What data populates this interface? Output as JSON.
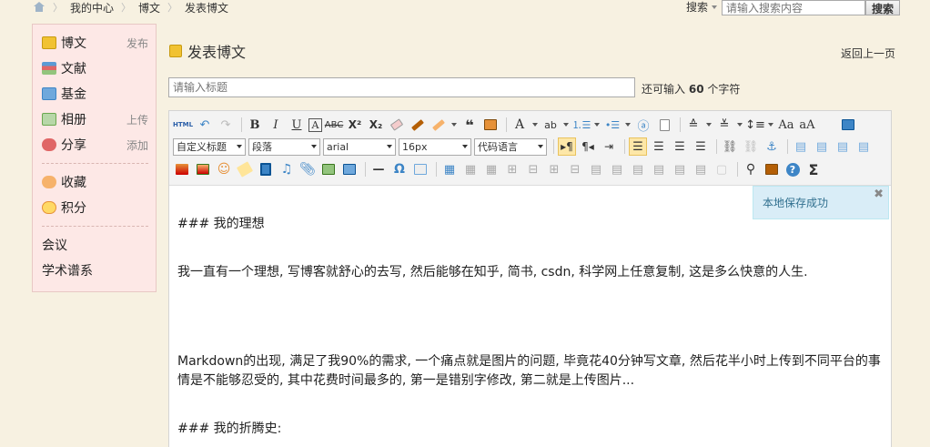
{
  "breadcrumb": {
    "items": [
      "我的中心",
      "博文",
      "发表博文"
    ]
  },
  "search": {
    "select_label": "搜索",
    "placeholder": "请输入搜索内容",
    "button": "搜索"
  },
  "sidebar": {
    "items": [
      {
        "label": "博文",
        "action": "发布"
      },
      {
        "label": "文献",
        "action": ""
      },
      {
        "label": "基金",
        "action": ""
      },
      {
        "label": "相册",
        "action": "上传"
      },
      {
        "label": "分享",
        "action": "添加"
      },
      {
        "label": "收藏",
        "action": ""
      },
      {
        "label": "积分",
        "action": ""
      },
      {
        "label": "会议",
        "action": ""
      },
      {
        "label": "学术谱系",
        "action": ""
      }
    ]
  },
  "page": {
    "title": "发表博文",
    "back_link": "返回上一页"
  },
  "title_field": {
    "placeholder": "请输入标题",
    "hint_prefix": "还可输入",
    "hint_count": "60",
    "hint_suffix": "个字符"
  },
  "toolbar": {
    "html_label": "HTML",
    "custom_title_select": "自定义标题",
    "paragraph_select": "段落",
    "font_select": "arial",
    "size_select": "16px",
    "code_lang_select": "代码语言",
    "icons": [
      "undo-icon",
      "redo-icon",
      "bold-icon",
      "italic-icon",
      "underline-icon",
      "strikethrough-icon",
      "superscript-icon",
      "subscript-icon",
      "eraser-icon",
      "format-brush-icon",
      "blockquote-icon",
      "paste-icon",
      "font-color-icon",
      "bg-color-icon",
      "ordered-list-icon",
      "unordered-list-icon",
      "preview-icon",
      "fullscreen-icon",
      "emoticon-icon",
      "image-icon",
      "video-icon",
      "music-icon",
      "attachment-icon",
      "map-icon",
      "table-icon",
      "search-replace-icon",
      "help-icon",
      "sigma-icon"
    ]
  },
  "toast": {
    "message": "本地保存成功",
    "close": "✖"
  },
  "content": {
    "heading1": "### 我的理想",
    "para1": "我一直有一个理想, 写博客就舒心的去写, 然后能够在知乎, 简书, csdn, 科学网上任意复制, 这是多么快意的人生.",
    "para2": "Markdown的出现, 满足了我90%的需求, 一个痛点就是图片的问题, 毕竟花40分钟写文章, 然后花半小时上传到不同平台的事情是不能够忍受的, 其中花费时间最多的, 第一是错别字修改, 第二就是上传图片...",
    "heading2": "### 我的折腾史:"
  }
}
